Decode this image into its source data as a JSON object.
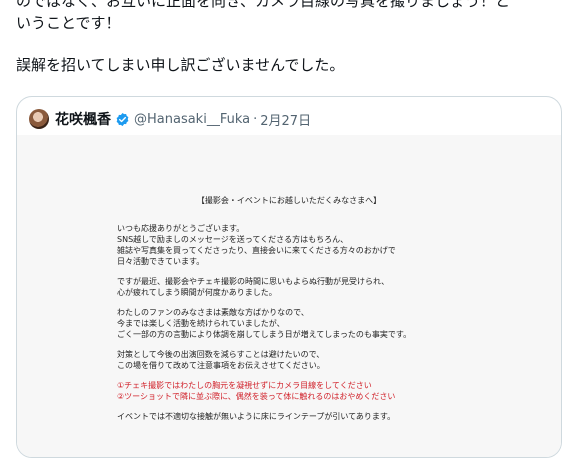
{
  "post": {
    "line1": "のではなく、お互いに正面を向き、カメラ目線の写真を撮りましょう！と",
    "line2": "いうことです！",
    "line3": "誤解を招いてしまい申し訳ございませんでした。"
  },
  "quote": {
    "name": "花咲楓香",
    "handle": "@Hanasaki__Fuka",
    "dot": "·",
    "date": "2月27日",
    "verified_color": "#1d9bf0",
    "doc": {
      "title": "【撮影会・イベントにお越しいただくみなさまへ】",
      "paragraphs": [
        [
          "いつも応援ありがとうございます。",
          "SNS越しで励ましのメッセージを送ってくださる方はもちろん、",
          "雑誌や写真集を買ってくださったり、直接会いに来てくださる方々のおかげで",
          "日々活動できています。"
        ],
        [
          "ですが最近、撮影会やチェキ撮影の時間に思いもよらぬ行動が見受けられ、",
          "心が疲れてしまう瞬間が何度かありました。"
        ],
        [
          "わたしのファンのみなさまは素敵な方ばかりなので、",
          "今までは楽しく活動を続けられていましたが、",
          "ごく一部の方の言動により体調を崩してしまう日が増えてしまったのも事実です。"
        ],
        [
          "対策として今後の出演回数を減らすことは避けたいので、",
          "この場を借りて改めて注意事項をお伝えさせてください。"
        ]
      ],
      "rules": [
        "①チェキ撮影ではわたしの胸元を凝視せずにカメラ目線をしてください",
        "②ツーショットで隣に並ぶ際に、偶然を装って体に触れるのはおやめください"
      ],
      "footer": "イベントでは不適切な接触が無いように床にラインテープが引いてあります。",
      "rule_color": "#d1212a"
    }
  }
}
